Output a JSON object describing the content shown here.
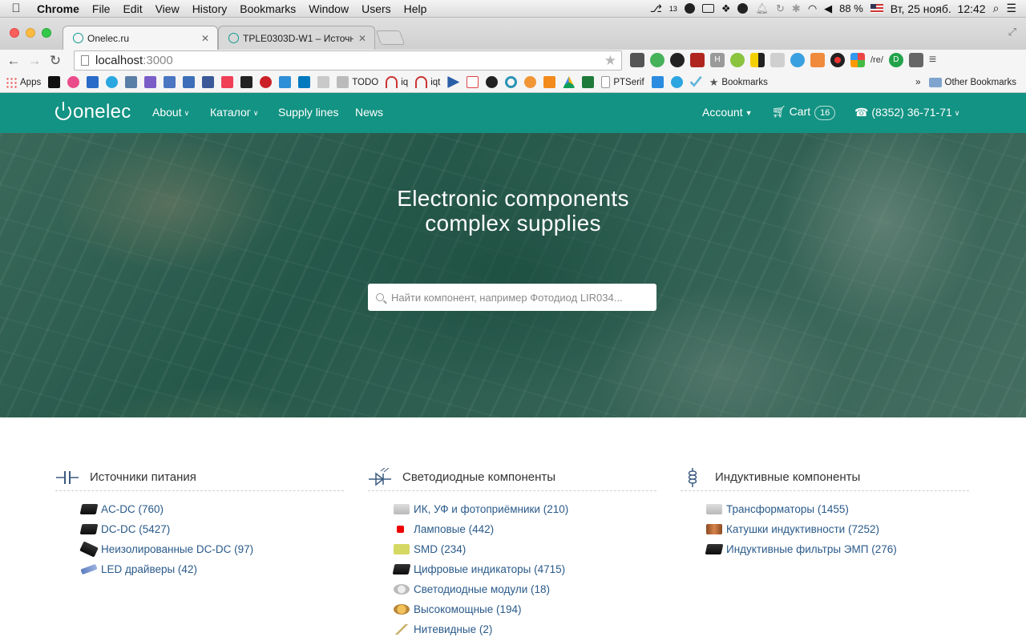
{
  "mac_menubar": {
    "app": "Chrome",
    "menus": [
      "File",
      "Edit",
      "View",
      "History",
      "Bookmarks",
      "Window",
      "Users",
      "Help"
    ],
    "tray_badge": "13",
    "battery": "88 %",
    "datetime": "Вт, 25 нояб.  12:42"
  },
  "tabs": [
    {
      "title": "Onelec.ru",
      "active": true
    },
    {
      "title": "TPLE0303D-W1 – Источни",
      "active": false
    }
  ],
  "address": {
    "host": "localhost",
    "port": ":3000"
  },
  "toolbar_ext_text": "/re/",
  "bookmarks": {
    "apps": "Apps",
    "todo": "TODO",
    "iq": "iq",
    "iqt": "iqt",
    "ptserif": "PTSerif",
    "bookmarks": "Bookmarks",
    "more": "»",
    "other": "Other Bookmarks"
  },
  "site": {
    "logo": "onelec",
    "nav": {
      "about": "About",
      "catalog": "Каталог",
      "supply": "Supply lines",
      "news": "News",
      "account": "Account",
      "cart": "Cart",
      "cart_count": "16",
      "phone": "(8352) 36-71-71"
    },
    "hero": {
      "title_line1": "Electronic components",
      "title_line2": "complex supplies",
      "search_placeholder": "Найти компонент, например Фотодиод LIR034..."
    },
    "categories": [
      {
        "title": "Источники питания",
        "items": [
          "AC-DC (760)",
          "DC-DC (5427)",
          "Неизолированные DC-DC (97)",
          "LED драйверы (42)"
        ]
      },
      {
        "title": "Светодиодные компоненты",
        "items": [
          "ИК, УФ и фотоприёмники (210)",
          "Ламповые (442)",
          "SMD (234)",
          "Цифровые индикаторы (4715)",
          "Светодиодные модули (18)",
          "Высокомощные (194)",
          "Нитевидные (2)"
        ]
      },
      {
        "title": "Индуктивные компоненты",
        "items": [
          "Трансформаторы (1455)",
          "Катушки индуктивности (7252)",
          "Индуктивные фильтры ЭМП (276)"
        ]
      }
    ]
  },
  "colors": {
    "brand": "#139383",
    "link": "#2a5a8a"
  }
}
